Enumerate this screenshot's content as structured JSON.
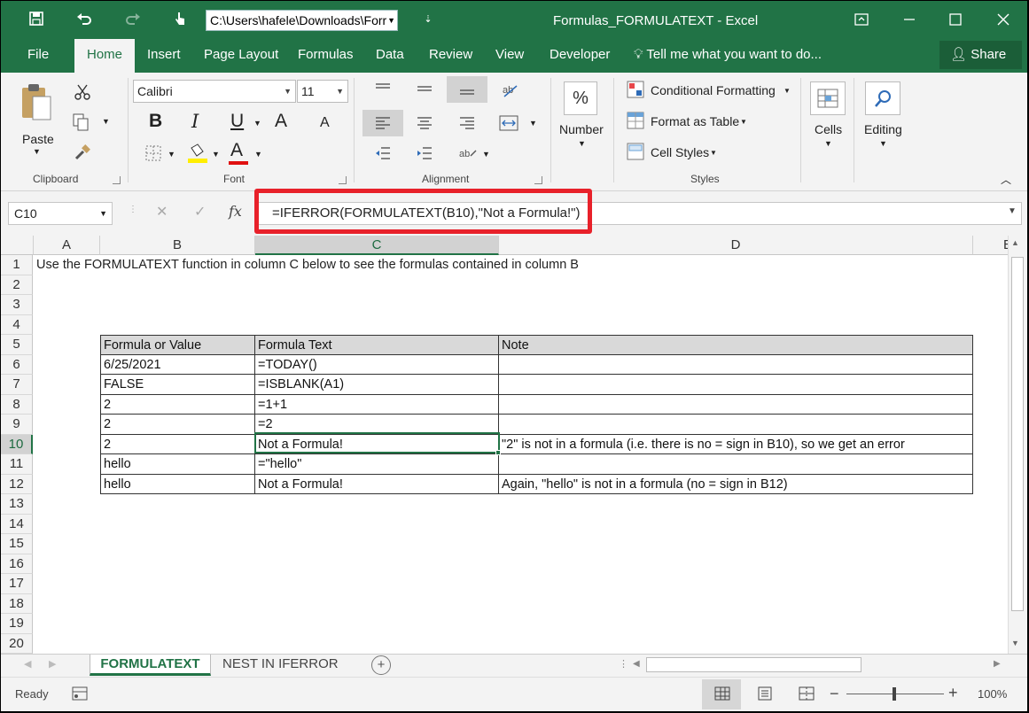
{
  "title_bar": {
    "file_path": "C:\\Users\\hafele\\Downloads\\Forr",
    "window_title": "Formulas_FORMULATEXT - Excel"
  },
  "tabs": [
    "File",
    "Home",
    "Insert",
    "Page Layout",
    "Formulas",
    "Data",
    "Review",
    "View",
    "Developer"
  ],
  "tell_me": "Tell me what you want to do...",
  "share_label": "Share",
  "ribbon": {
    "clipboard": {
      "paste": "Paste",
      "label": "Clipboard"
    },
    "font": {
      "name": "Calibri",
      "size": "11",
      "label": "Font",
      "bold": "B",
      "italic": "I",
      "underline": "U",
      "grow": "A",
      "shrink": "A",
      "font_color": "A"
    },
    "alignment": {
      "label": "Alignment"
    },
    "number": {
      "button": "Number",
      "symbol": "%"
    },
    "styles": {
      "conditional": "Conditional Formatting",
      "format_table": "Format as Table",
      "cell_styles": "Cell Styles",
      "label": "Styles"
    },
    "cells": {
      "button": "Cells"
    },
    "editing": {
      "button": "Editing"
    }
  },
  "formula_bar": {
    "name_box": "C10",
    "fx": "fx",
    "formula": "=IFERROR(FORMULATEXT(B10),\"Not a Formula!\")"
  },
  "columns": [
    "A",
    "B",
    "C",
    "D",
    "E"
  ],
  "rows": [
    "1",
    "2",
    "3",
    "4",
    "5",
    "6",
    "7",
    "8",
    "9",
    "10",
    "11",
    "12",
    "13",
    "14",
    "15",
    "16",
    "17",
    "18",
    "19",
    "20"
  ],
  "sheet": {
    "a1": "Use the FORMULATEXT function in column C below to see the formulas contained in column B",
    "headers": [
      "Formula or Value",
      "Formula Text",
      "Note"
    ],
    "table": [
      [
        "6/25/2021",
        "=TODAY()",
        ""
      ],
      [
        "FALSE",
        "=ISBLANK(A1)",
        ""
      ],
      [
        "2",
        "=1+1",
        ""
      ],
      [
        "2",
        "=2",
        ""
      ],
      [
        "2",
        "Not a Formula!",
        "\"2\" is not in a formula (i.e. there is no = sign in B10), so we get an error"
      ],
      [
        "hello",
        "=\"hello\"",
        ""
      ],
      [
        "hello",
        "Not a Formula!",
        "Again, \"hello\" is not in a formula (no = sign in B12)"
      ]
    ]
  },
  "sheet_tabs": [
    "FORMULATEXT",
    "NEST IN IFERROR"
  ],
  "status": {
    "ready": "Ready",
    "zoom": "100%"
  },
  "colors": {
    "accent": "#217346",
    "highlight_box": "#e8212a"
  }
}
